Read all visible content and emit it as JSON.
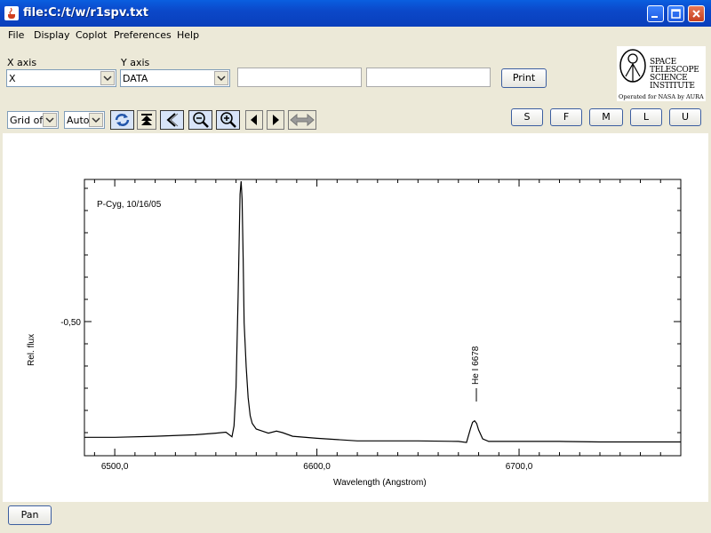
{
  "window": {
    "title": "file:C:/t/w/r1spv.txt"
  },
  "menu": [
    "File",
    "Display",
    "Coplot",
    "Preferences",
    "Help"
  ],
  "axes_controls": {
    "x_label": "X axis",
    "x_value": "X",
    "y_label": "Y axis",
    "y_value": "DATA",
    "print_label": "Print"
  },
  "logo": {
    "lines": [
      "SPACE",
      "TELESCOPE",
      "SCIENCE",
      "INSTITUTE"
    ],
    "footer": "Operated for NASA by AURA"
  },
  "toolbar": {
    "grid_value": "Grid off",
    "scale_value": "Auto"
  },
  "size_buttons": [
    "S",
    "F",
    "M",
    "L",
    "U"
  ],
  "pan_label": "Pan",
  "icons": [
    "refresh-icon",
    "top-icon",
    "back-icon",
    "zoom-out-icon",
    "zoom-in-icon",
    "left-arrow-icon",
    "right-arrow-icon",
    "pan-arrows-icon"
  ],
  "chart_data": {
    "type": "line",
    "annotation_text": "P-Cyg, 10/16/05",
    "line_label": "He I 6678",
    "xlabel": "Wavelength (Angstrom)",
    "ylabel": "Rel. flux",
    "x_ticks": [
      "6500,0",
      "6600,0",
      "6700,0"
    ],
    "y_ticks": [
      "-0,50"
    ],
    "xlim": [
      6485,
      6780
    ],
    "series": [
      {
        "x": [
          6485,
          6500,
          6520,
          6540,
          6550,
          6555,
          6558,
          6559,
          6560,
          6561,
          6562,
          6562.5,
          6563,
          6563.5,
          6564,
          6565,
          6566,
          6567,
          6568,
          6570,
          6573,
          6576,
          6580,
          6583,
          6588,
          6600,
          6620,
          6650,
          6670,
          6674,
          6676,
          6677,
          6678,
          6679,
          6680,
          6682,
          6685,
          6700,
          6720,
          6740,
          6760,
          6780
        ],
        "y": [
          0.006,
          0.006,
          0.01,
          0.016,
          0.022,
          0.026,
          0.008,
          0.05,
          0.2,
          0.55,
          0.95,
          1.0,
          0.93,
          0.7,
          0.45,
          0.28,
          0.16,
          0.09,
          0.06,
          0.038,
          0.03,
          0.022,
          0.03,
          0.024,
          0.01,
          0.002,
          -0.008,
          -0.008,
          -0.01,
          -0.014,
          0.04,
          0.064,
          0.07,
          0.06,
          0.035,
          0.0,
          -0.01,
          -0.01,
          -0.01,
          -0.012,
          -0.012,
          -0.012
        ]
      }
    ]
  }
}
